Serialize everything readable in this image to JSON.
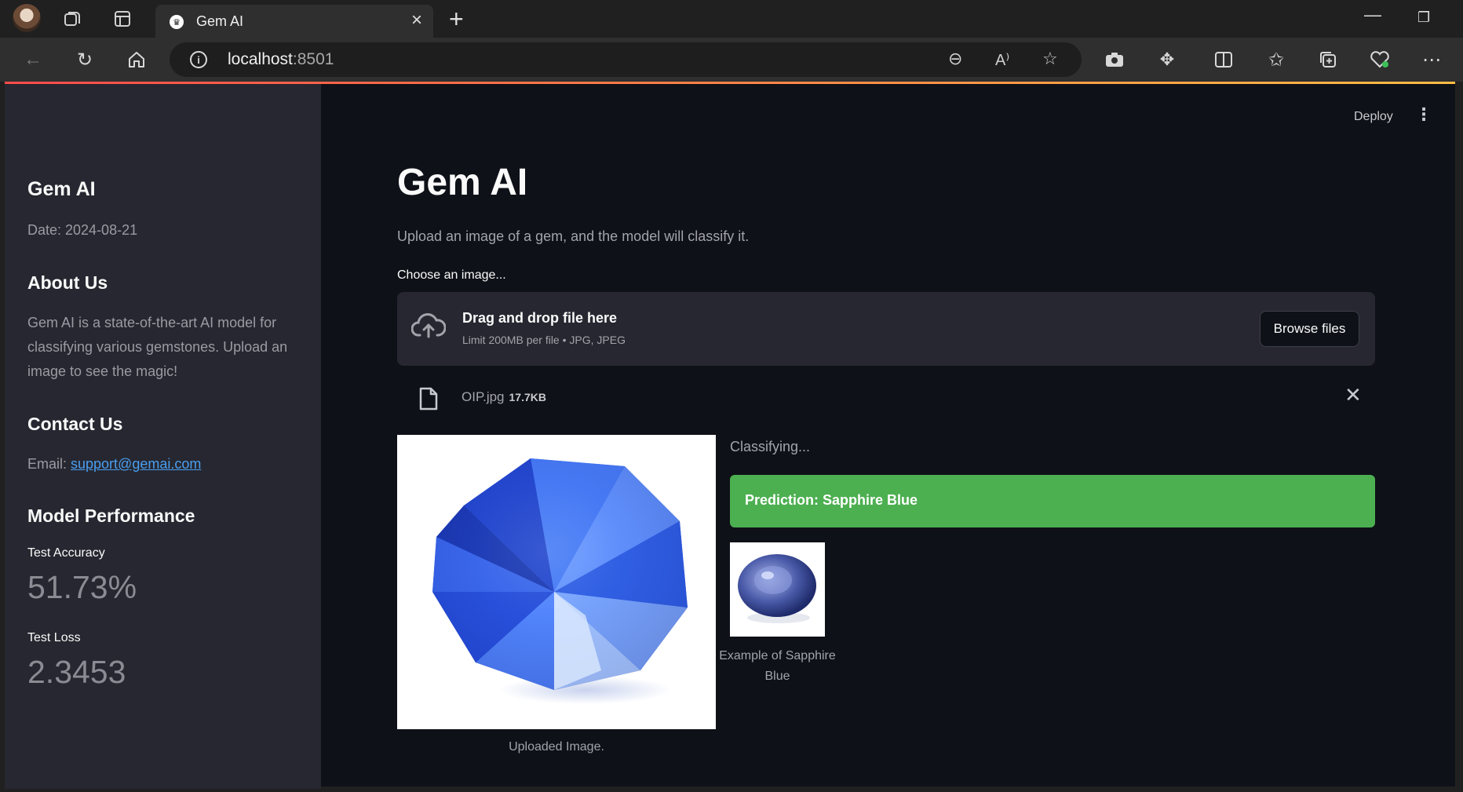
{
  "browser": {
    "tab_title": "Gem AI",
    "url_host": "localhost",
    "url_port": ":8501"
  },
  "app": {
    "deploy_label": "Deploy"
  },
  "sidebar": {
    "title": "Gem AI",
    "date": "Date: 2024-08-21",
    "about_heading": "About Us",
    "about_text": "Gem AI is a state-of-the-art AI model for classifying various gemstones. Upload an image to see the magic!",
    "contact_heading": "Contact Us",
    "email_label": "Email: ",
    "email": "support@gemai.com",
    "performance_heading": "Model Performance",
    "metrics": [
      {
        "label": "Test Accuracy",
        "value": "51.73%"
      },
      {
        "label": "Test Loss",
        "value": "2.3453"
      }
    ]
  },
  "main": {
    "title": "Gem AI",
    "subtitle": "Upload an image of a gem, and the model will classify it.",
    "uploader_label": "Choose an image...",
    "dropzone_text": "Drag and drop file here",
    "dropzone_limit": "Limit 200MB per file • JPG, JPEG",
    "browse_label": "Browse files",
    "file_name": "OIP.jpg",
    "file_size": "17.7KB",
    "uploaded_caption": "Uploaded Image.",
    "status_text": "Classifying...",
    "prediction": "Prediction: Sapphire Blue",
    "example_caption": "Example of Sapphire Blue"
  }
}
